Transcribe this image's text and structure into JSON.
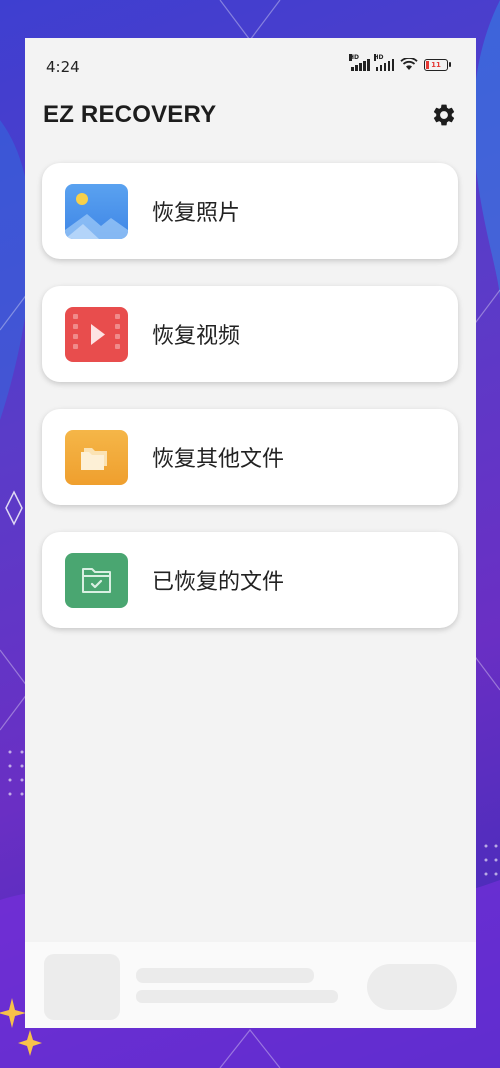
{
  "status_bar": {
    "time": "4:24",
    "signal_1_tag": "HD",
    "signal_2_tag": "HD",
    "battery_level": "11",
    "icons": [
      "signal-icon",
      "signal-icon",
      "wifi-icon",
      "battery-icon"
    ]
  },
  "header": {
    "title": "EZ RECOVERY",
    "settings_icon": "gear-icon"
  },
  "menu": {
    "items": [
      {
        "label": "恢复照片",
        "icon": "image-icon",
        "color": "#4a90e8"
      },
      {
        "label": "恢复视频",
        "icon": "video-icon",
        "color": "#e84d4d"
      },
      {
        "label": "恢复其他文件",
        "icon": "folder-icon",
        "color": "#f2a93b"
      },
      {
        "label": "已恢复的文件",
        "icon": "folder-check-icon",
        "color": "#4aa671"
      }
    ]
  },
  "colors": {
    "panel_bg": "#f3f3f3",
    "background": "#5a3cc8"
  }
}
